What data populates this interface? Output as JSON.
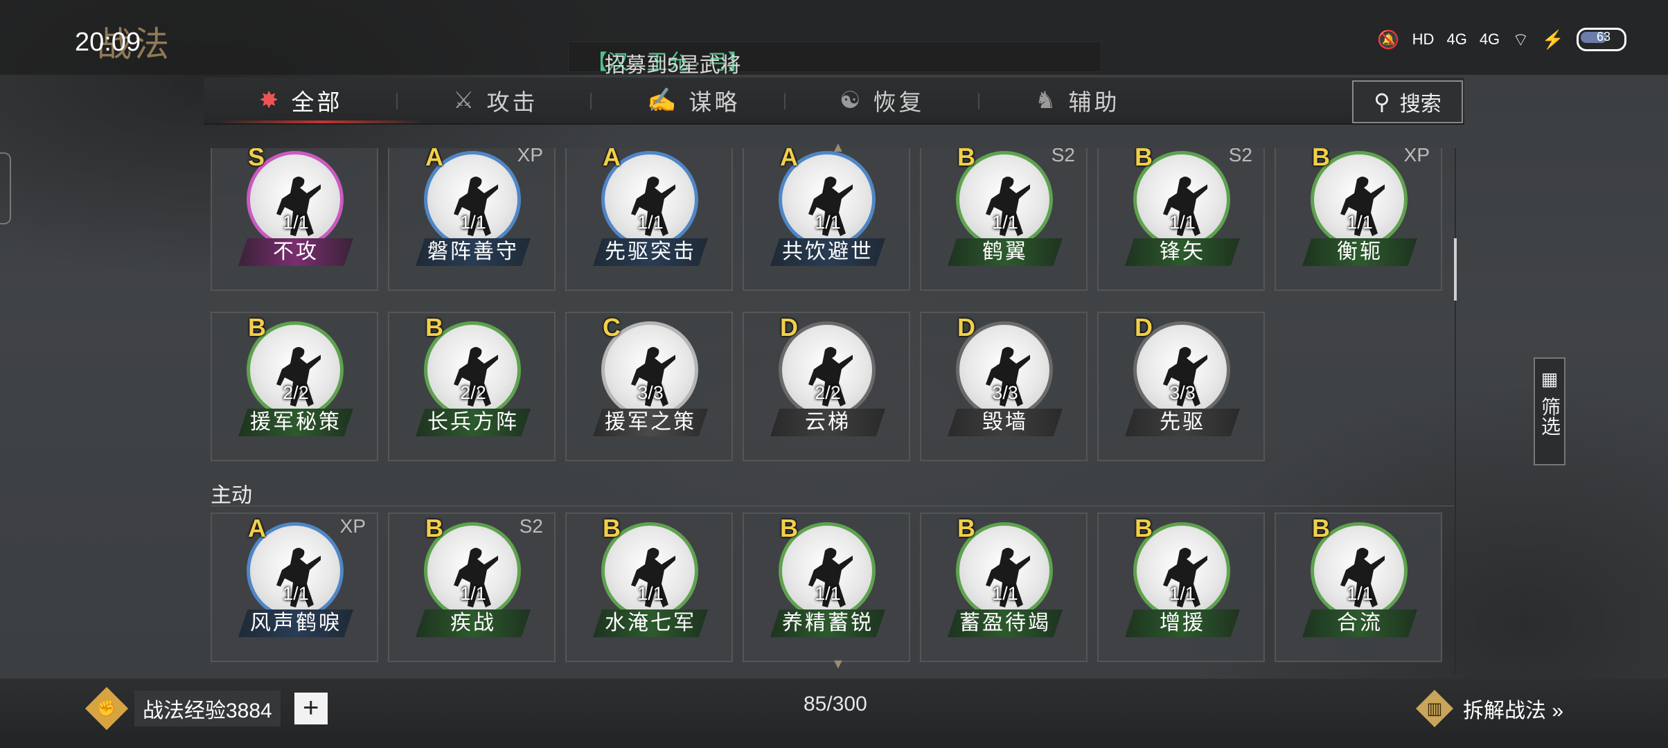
{
  "status_bar": {
    "time": "20:09",
    "signal_1": "4G",
    "signal_2": "4G",
    "hd": "HD",
    "battery": "63"
  },
  "page_logo": "战法",
  "marquee": {
    "prefix": "招募到5星武将",
    "highlight": "【汉 · 王允 · 弓】"
  },
  "tabs": [
    {
      "label": "全部",
      "icon": "all-icon",
      "active": true
    },
    {
      "label": "攻击",
      "icon": "swords-icon",
      "active": false
    },
    {
      "label": "谋略",
      "icon": "scroll-icon",
      "active": false
    },
    {
      "label": "恢复",
      "icon": "heal-icon",
      "active": false
    },
    {
      "label": "辅助",
      "icon": "support-icon",
      "active": false
    }
  ],
  "search": {
    "label": "搜索",
    "icon": "search-icon"
  },
  "rows_top": [
    [
      {
        "grade": "S",
        "tag": "",
        "count": "1/1",
        "name": "不攻"
      },
      {
        "grade": "A",
        "tag": "XP",
        "count": "1/1",
        "name": "磐阵善守"
      },
      {
        "grade": "A",
        "tag": "",
        "count": "1/1",
        "name": "先驱突击"
      },
      {
        "grade": "A",
        "tag": "",
        "count": "1/1",
        "name": "共饮避世"
      },
      {
        "grade": "B",
        "tag": "S2",
        "count": "1/1",
        "name": "鹤翼"
      },
      {
        "grade": "B",
        "tag": "S2",
        "count": "1/1",
        "name": "锋矢"
      },
      {
        "grade": "B",
        "tag": "XP",
        "count": "1/1",
        "name": "衡轭"
      }
    ],
    [
      {
        "grade": "B",
        "tag": "",
        "count": "2/2",
        "name": "援军秘策"
      },
      {
        "grade": "B",
        "tag": "",
        "count": "2/2",
        "name": "长兵方阵"
      },
      {
        "grade": "C",
        "tag": "",
        "count": "3/3",
        "name": "援军之策"
      },
      {
        "grade": "D",
        "tag": "",
        "count": "2/2",
        "name": "云梯"
      },
      {
        "grade": "D",
        "tag": "",
        "count": "3/3",
        "name": "毁墙"
      },
      {
        "grade": "D",
        "tag": "",
        "count": "3/3",
        "name": "先驱"
      }
    ]
  ],
  "section_active": {
    "label": "主动"
  },
  "rows_active": [
    [
      {
        "grade": "A",
        "tag": "XP",
        "count": "1/1",
        "name": "风声鹤唳"
      },
      {
        "grade": "B",
        "tag": "S2",
        "count": "1/1",
        "name": "疾战"
      },
      {
        "grade": "B",
        "tag": "",
        "count": "1/1",
        "name": "水淹七军"
      },
      {
        "grade": "B",
        "tag": "",
        "count": "1/1",
        "name": "养精蓄锐"
      },
      {
        "grade": "B",
        "tag": "",
        "count": "1/1",
        "name": "蓄盈待竭"
      },
      {
        "grade": "B",
        "tag": "",
        "count": "1/1",
        "name": "增援"
      },
      {
        "grade": "B",
        "tag": "",
        "count": "1/1",
        "name": "合流"
      }
    ]
  ],
  "filter": {
    "label": "筛选",
    "icon": "grid-icon"
  },
  "bottom": {
    "exp_label": "战法经验3884",
    "plus": "+",
    "capacity": "85/300",
    "dismantle": "拆解战法 »"
  }
}
